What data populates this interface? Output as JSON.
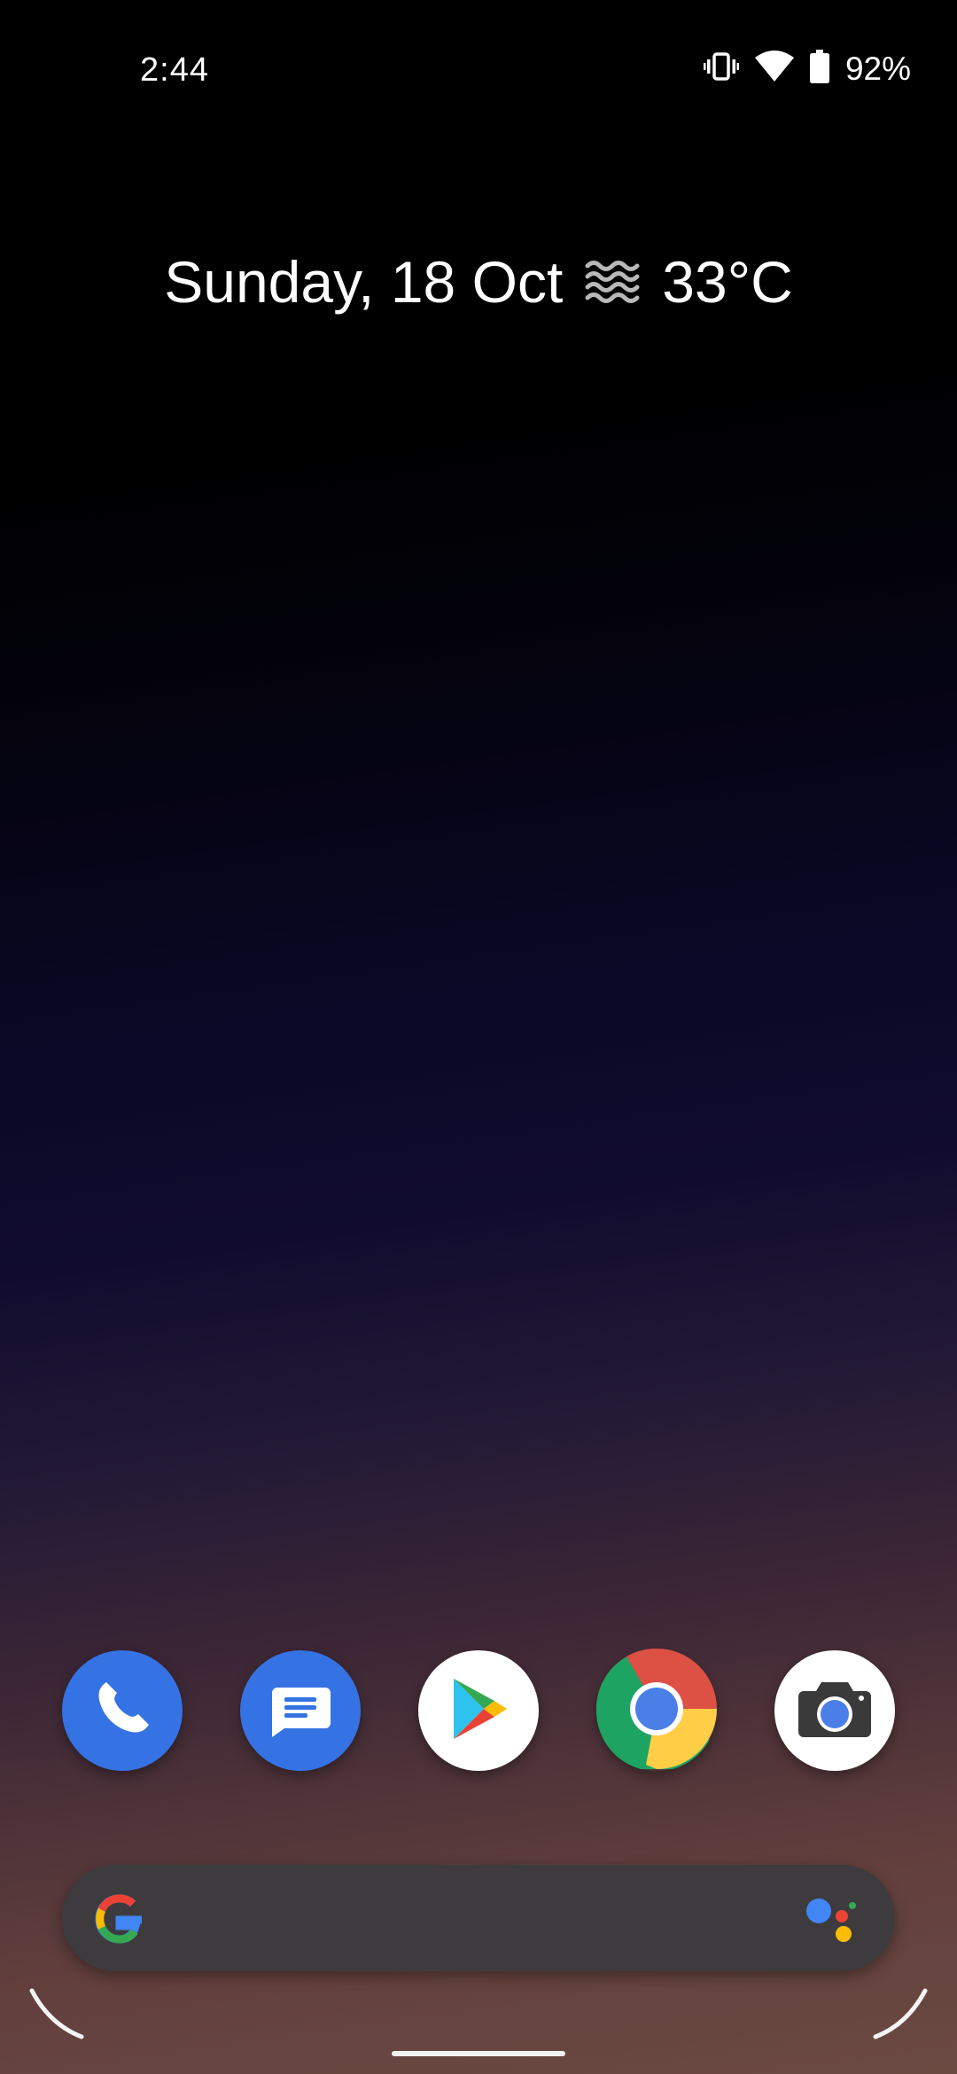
{
  "status_bar": {
    "time": "2:44",
    "battery_percent": "92%",
    "icons": [
      "vibrate-icon",
      "wifi-icon",
      "battery-icon"
    ]
  },
  "glance": {
    "date": "Sunday, 18 Oct",
    "weather_icon": "haze-icon",
    "temperature": "33°C"
  },
  "dock": {
    "apps": [
      {
        "name": "Phone",
        "icon": "phone-icon"
      },
      {
        "name": "Messages",
        "icon": "messages-icon"
      },
      {
        "name": "Play Store",
        "icon": "play-store-icon"
      },
      {
        "name": "Chrome",
        "icon": "chrome-icon"
      },
      {
        "name": "Camera",
        "icon": "camera-icon"
      }
    ]
  },
  "search_bar": {
    "left_icon": "google-g-icon",
    "right_icon": "google-assistant-icon"
  },
  "colors": {
    "accent_blue": "#3572e3",
    "search_bg": "#3d3b3d"
  }
}
